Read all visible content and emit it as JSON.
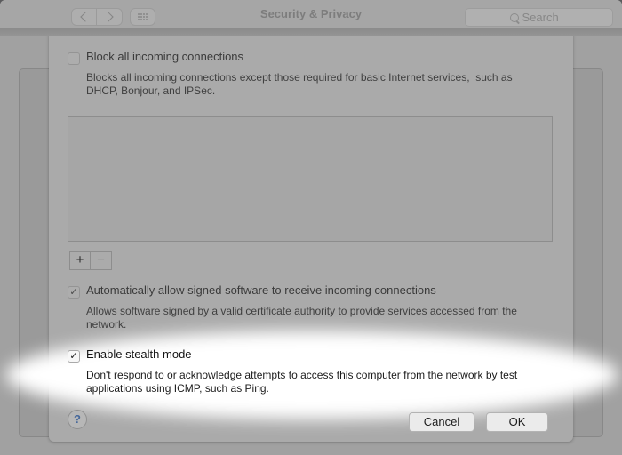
{
  "titlebar": {
    "title": "Security & Privacy",
    "search": {
      "placeholder": "Search"
    }
  },
  "firewall_sheet": {
    "block_incoming": {
      "label": "Block all incoming connections",
      "checked": false,
      "desc_line1": "Blocks all incoming connections except those required for basic Internet services,  such as",
      "desc_line2": "DHCP, Bonjour, and IPSec."
    },
    "allowed_apps_list": {
      "items": [],
      "add_label": "+",
      "remove_label": "−"
    },
    "auto_allow_signed": {
      "label": "Automatically allow signed software to receive incoming connections",
      "checked": true,
      "desc_line1": "Allows software signed by a valid certificate authority to provide services accessed from the",
      "desc_line2": "network."
    },
    "stealth_mode": {
      "label": "Enable stealth mode",
      "checked": true,
      "desc_line1": "Don't respond to or acknowledge attempts to access this computer from the network by test",
      "desc_line2": "applications using ICMP, such as Ping."
    },
    "help_label": "?",
    "cancel_label": "Cancel",
    "ok_label": "OK"
  },
  "glyphs": {
    "check": "✓"
  },
  "colors": {
    "sheet_bg": "#aaaaaa",
    "window_bg": "#a1a1a1",
    "titlebar_bg": "#a6a6a6",
    "spotlight": "#ffffff",
    "help_blue": "#46689b"
  }
}
